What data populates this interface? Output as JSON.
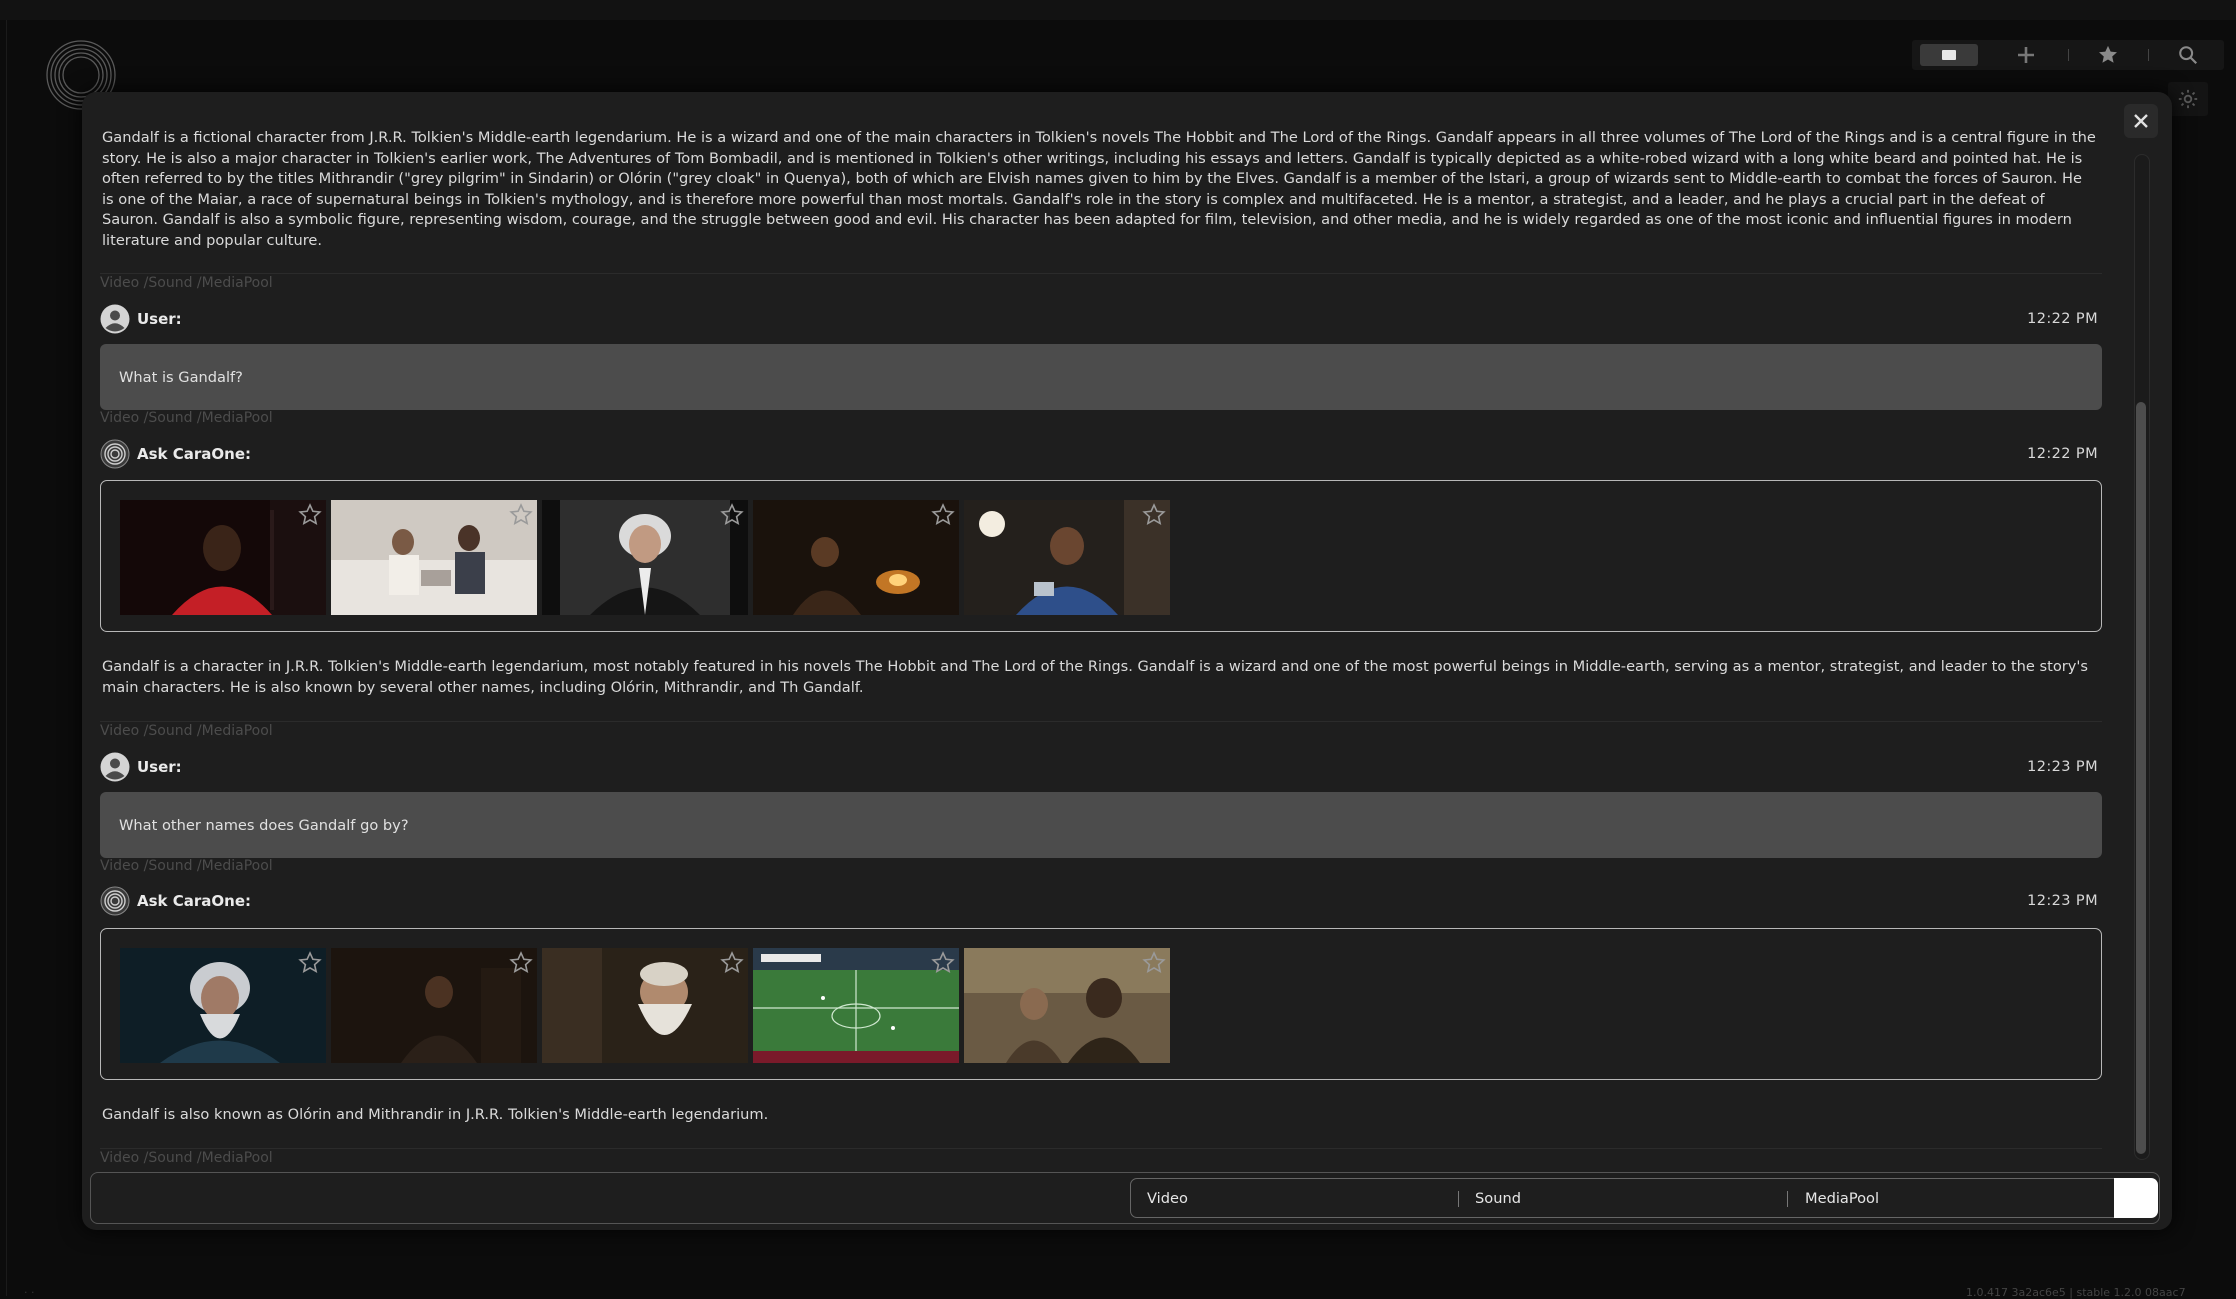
{
  "app": {
    "version": "1.0.417 3a2ac6e5 | stable 1.2.0 08aac7",
    "corner_text": "· ·"
  },
  "toolbar": {
    "items": [
      "screen-icon",
      "plus-icon",
      "star-icon",
      "search-icon",
      "gear-icon"
    ]
  },
  "chat": {
    "intro_text": "Gandalf is a fictional character from J.R.R. Tolkien's Middle-earth legendarium. He is a wizard and one of the main characters in Tolkien's novels The Hobbit and The Lord of the Rings. Gandalf appears in all three volumes of The Lord of the Rings and is a central figure in the story. He is also a major character in Tolkien's earlier work, The Adventures of Tom Bombadil, and is mentioned in Tolkien's other writings, including his essays and letters. Gandalf is typically depicted as a white-robed wizard with a long white beard and pointed hat. He is often referred to by the titles Mithrandir (\"grey pilgrim\" in Sindarin) or Olórin (\"grey cloak\" in Quenya), both of which are Elvish names given to him by the Elves. Gandalf is a member of the Istari, a group of wizards sent to Middle-earth to combat the forces of Sauron. He is one of the Maiar, a race of supernatural beings in Tolkien's mythology, and is therefore more powerful than most mortals. Gandalf's role in the story is complex and multifaceted. He is a mentor, a strategist, and a leader, and he plays a crucial part in the defeat of Sauron. Gandalf is also a symbolic figure, representing wisdom, courage, and the struggle between good and evil. His character has been adapted for film, television, and other media, and he is widely regarded as one of the most iconic and influential figures in modern literature and popular culture.",
    "source_label": "Video /Sound /MediaPool",
    "messages": [
      {
        "sender": "User:",
        "time": "12:22 PM",
        "text": "What is Gandalf?"
      },
      {
        "sender": "Ask CaraOne:",
        "time": "12:22 PM",
        "text": "Gandalf is a character in J.R.R. Tolkien's Middle-earth legendarium, most notably featured in his novels The Hobbit and The Lord of the Rings. Gandalf is a wizard and one of the most powerful beings in Middle-earth, serving as a mentor, strategist, and leader to the story's main characters. He is also known by several other names, including Olórin, Mithrandir, and Th Gandalf."
      },
      {
        "sender": "User:",
        "time": "12:23 PM",
        "text": "What other names does Gandalf go by?"
      },
      {
        "sender": "Ask CaraOne:",
        "time": "12:23 PM",
        "text": "Gandalf is also known as Olórin and Mithrandir in J.R.R. Tolkien's Middle-earth legendarium."
      }
    ]
  },
  "input": {
    "value": "",
    "options": [
      "Video",
      "Sound",
      "MediaPool"
    ]
  },
  "colors": {
    "panel": "#1e1e1e",
    "user_bubble": "#4c4c4c",
    "media_border": "#b8b8b8",
    "scroll_thumb": "#4d4d4d"
  }
}
